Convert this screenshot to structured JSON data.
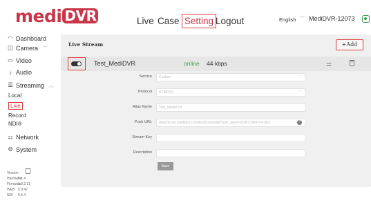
{
  "header": {
    "logo_medi": "medi",
    "logo_dvr": "DVR",
    "nav": {
      "live": "Live",
      "case": "Case",
      "setting": "Setting",
      "logout": "Logout"
    },
    "language": "English",
    "device_name": "MediDVR-12073"
  },
  "sidebar": {
    "dashboard": "Dashboard",
    "camera": "Camera",
    "video": "Video",
    "audio": "Audio",
    "streaming": "Streaming",
    "sub": {
      "local": "Local",
      "live": "Live",
      "record": "Record",
      "ndi": "NDI®"
    },
    "network": "Network",
    "system": "System",
    "version": {
      "label": "Version",
      "rows": [
        {
          "k": "Hardware",
          "v": "5.1.4"
        },
        {
          "k": "Firmware",
          "v": "1.0.2.21"
        },
        {
          "k": "WEB",
          "v": "6.9.42"
        },
        {
          "k": "NDI",
          "v": "5.5.4"
        }
      ]
    }
  },
  "main": {
    "title": "Live Stream",
    "add_label": "+Add",
    "stream": {
      "name": "Test_MediDVR",
      "status": "online",
      "bitrate": "44 kbps"
    },
    "form": {
      "service_label": "Service",
      "service_value": "Custom",
      "protocol_label": "Protocol",
      "protocol_value": "RTMP(S)",
      "alias_label": "Alias Name",
      "alias_value": "Test_MediDVR",
      "push_label": "Push URL",
      "push_value": "rtmp://push.medibird.com/test/t/zoelstek?auth_key=1629073289-0-0-6b2",
      "key_label": "Stream Key",
      "key_value": "",
      "desc_label": "Description",
      "desc_value": "",
      "save_label": "Save"
    }
  },
  "colors": {
    "brand": "#c9364a",
    "online": "#3a9e55",
    "highlight": "#e03a3a"
  }
}
